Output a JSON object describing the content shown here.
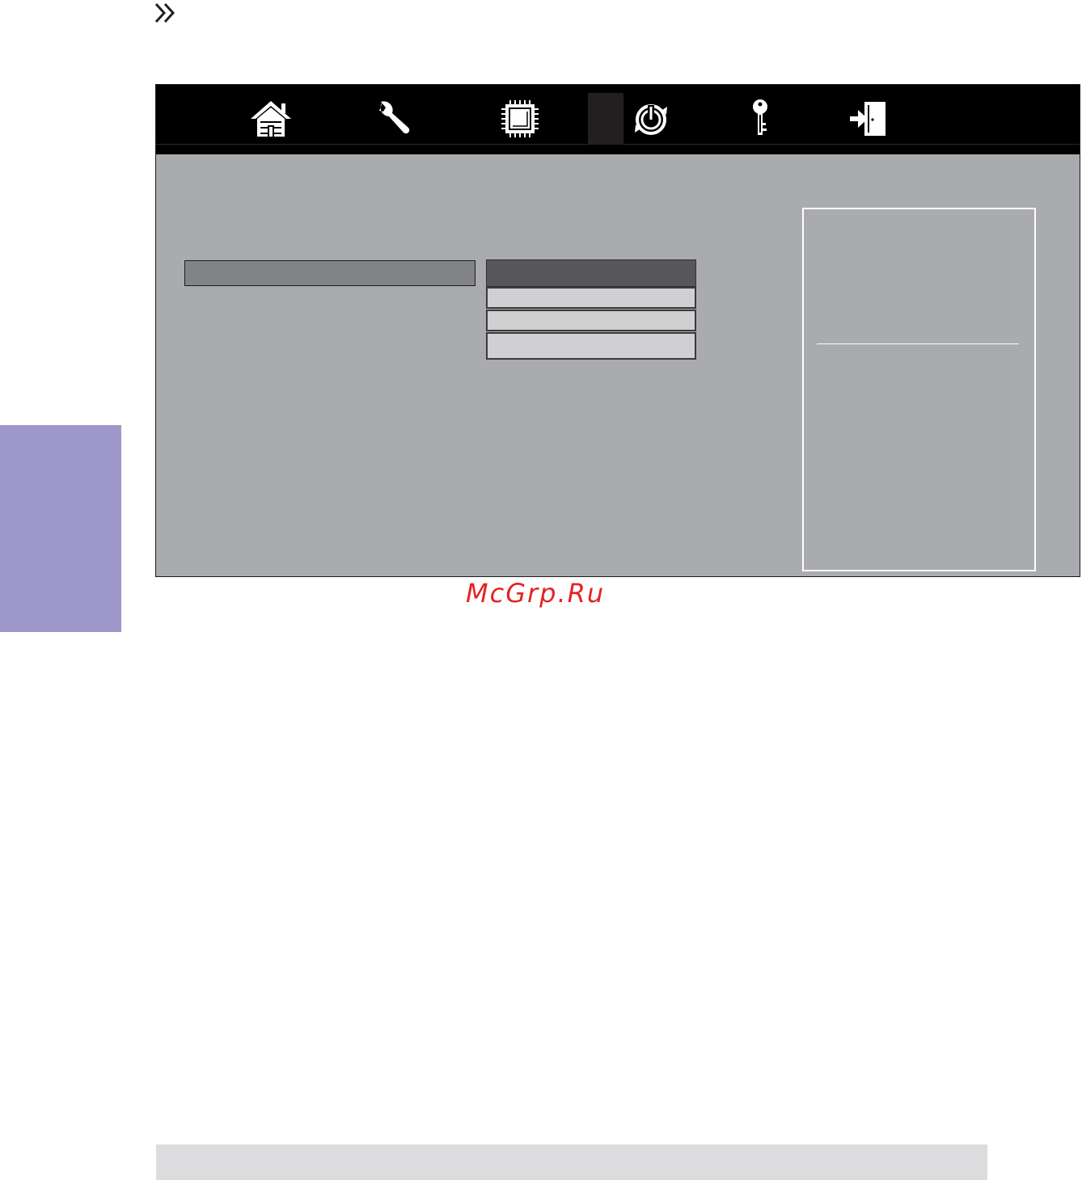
{
  "watermark": {
    "text": "McGrp.Ru",
    "color": "#e52322"
  },
  "nav": {
    "items": [
      {
        "id": "main",
        "icon": "home-icon"
      },
      {
        "id": "advanced",
        "icon": "wrench-icon"
      },
      {
        "id": "chipset",
        "icon": "chip-icon"
      },
      {
        "id": "boot",
        "icon": "power-icon",
        "selected": true
      },
      {
        "id": "security",
        "icon": "key-icon"
      },
      {
        "id": "exit",
        "icon": "exit-door-icon"
      }
    ]
  },
  "dropdown": {
    "options_count": 3
  },
  "colors": {
    "side_tab": "#9e97c9",
    "panel_bg": "#aaabae",
    "topbar": "#000000",
    "footer": "#dcdcde"
  }
}
